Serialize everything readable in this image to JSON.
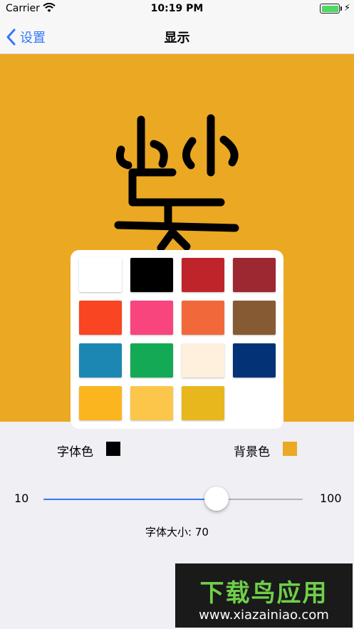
{
  "status_bar": {
    "carrier": "Carrier",
    "time": "10:19 PM",
    "battery_level": 1.0
  },
  "nav": {
    "back_label": "设置",
    "title": "显示"
  },
  "preview": {
    "background_color": "#eba823",
    "glyph_color": "#000000"
  },
  "palette": [
    "#ffffff",
    "#000000",
    "#c0242b",
    "#9e2832",
    "#f94522",
    "#f8457e",
    "#f1693b",
    "#865b33",
    "#1c87b3",
    "#14a954",
    "#fff0de",
    "#033276",
    "#fbb51f",
    "#fcc64b",
    "#e8b71d"
  ],
  "colors": {
    "font_color_label": "字体色",
    "font_color": "#000000",
    "background_color_label": "背景色",
    "background_color": "#eba823"
  },
  "slider": {
    "min_label": "10",
    "max_label": "100",
    "min": 10,
    "max": 100,
    "value": 70
  },
  "font_size_label": "字体大小: 70",
  "watermark": {
    "title": "下载鸟应用",
    "url": "www.xiazainiao.com"
  }
}
